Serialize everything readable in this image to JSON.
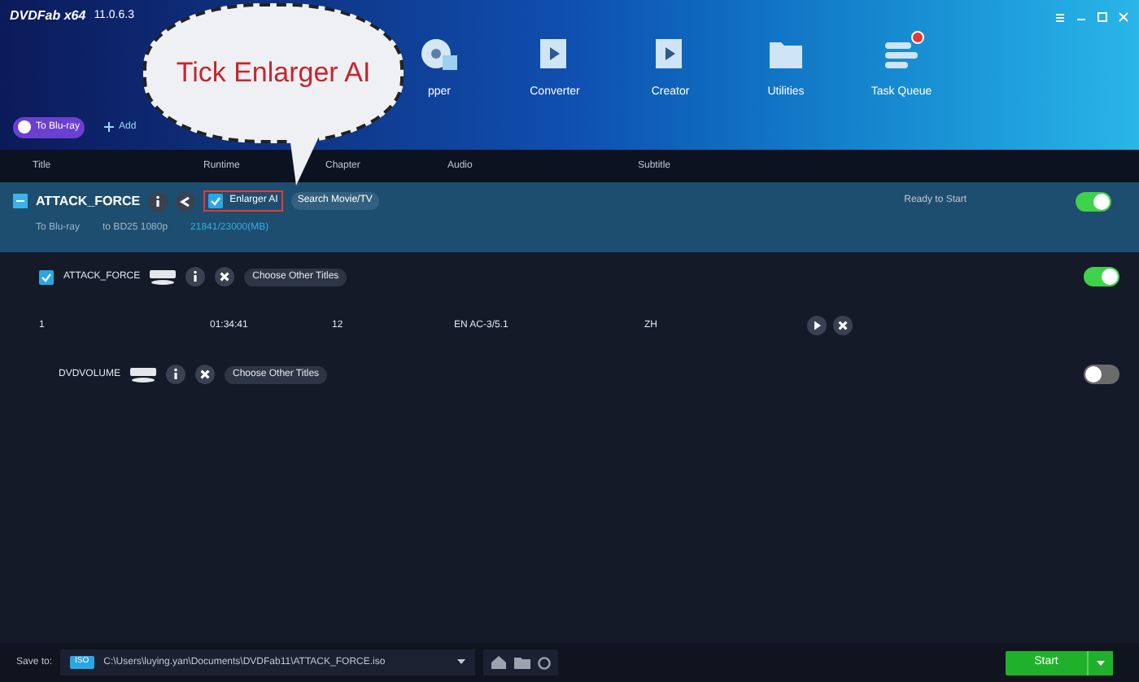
{
  "app": {
    "logo": "DVDFab x64",
    "version": "11.0.6.3"
  },
  "modules": [
    {
      "label": "pper",
      "badge": false
    },
    {
      "label": "Converter",
      "badge": false
    },
    {
      "label": "Creator",
      "badge": false
    },
    {
      "label": "Utilities",
      "badge": false
    },
    {
      "label": "Task Queue",
      "badge": true
    }
  ],
  "mode_button": "To Blu-ray",
  "add_button": "Add",
  "callout": "Tick Enlarger AI",
  "columns": [
    "Title",
    "Runtime",
    "Chapter",
    "Audio",
    "Subtitle"
  ],
  "task": {
    "title": "ATTACK_FORCE",
    "enlarger": {
      "label": "Enlarger AI",
      "checked": true
    },
    "search_button": "Search Movie/TV",
    "status": "Ready to Start",
    "on": true,
    "target": "To Blu-ray",
    "profile": "to BD25 1080p",
    "size": "21841/23000(MB)"
  },
  "sources": [
    {
      "title": "ATTACK_FORCE",
      "checked": true,
      "choose_button": "Choose Other Titles",
      "on": true,
      "titles": [
        {
          "number": "1",
          "runtime": "01:34:41",
          "chapter": "12",
          "audio": "EN AC-3/5.1",
          "subtitle": "ZH"
        }
      ]
    },
    {
      "title": "DVDVOLUME",
      "checked": false,
      "choose_button": "Choose Other Titles",
      "on": false
    }
  ],
  "footer": {
    "label": "Save to:",
    "format": "ISO",
    "path": "C:\\Users\\luying.yan\\Documents\\DVDFab11\\ATTACK_FORCE.iso",
    "start_button": "Start"
  }
}
